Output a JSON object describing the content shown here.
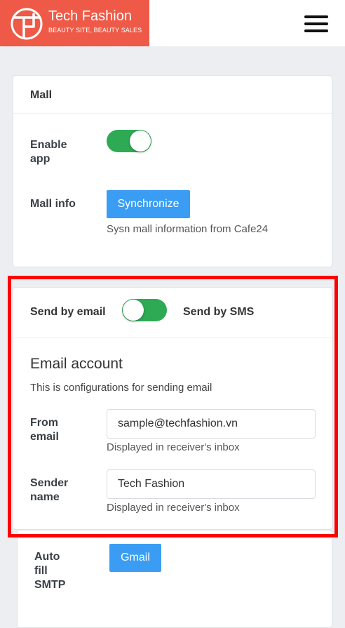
{
  "brand": {
    "name": "Tech Fashion",
    "tagline": "BEAUTY SITE, BEAUTY SALES",
    "color": "#ee5a47"
  },
  "menu_icon": "hamburger-menu-icon",
  "mall_card": {
    "title": "Mall",
    "enable_app_label": "Enable app",
    "enable_app_on": true,
    "mall_info_label": "Mall info",
    "sync_button": "Synchronize",
    "sync_help": "Sysn mall information from Cafe24"
  },
  "send_card": {
    "send_email_label": "Send by email",
    "send_sms_label": "Send by SMS",
    "toggle_state": "email",
    "section_title": "Email account",
    "section_desc": "This is configurations for sending email",
    "from_email_label": "From email",
    "from_email_value": "sample@techfashion.vn",
    "from_email_help": "Displayed in receiver's inbox",
    "sender_name_label": "Sender name",
    "sender_name_value": "Tech Fashion",
    "sender_name_help": "Displayed in receiver's inbox"
  },
  "smtp_card": {
    "auto_fill_label": "Auto fill SMTP",
    "gmail_button": "Gmail"
  },
  "colors": {
    "toggle_on": "#2eaa55",
    "button": "#3a9df3",
    "highlight": "#ff0000"
  }
}
